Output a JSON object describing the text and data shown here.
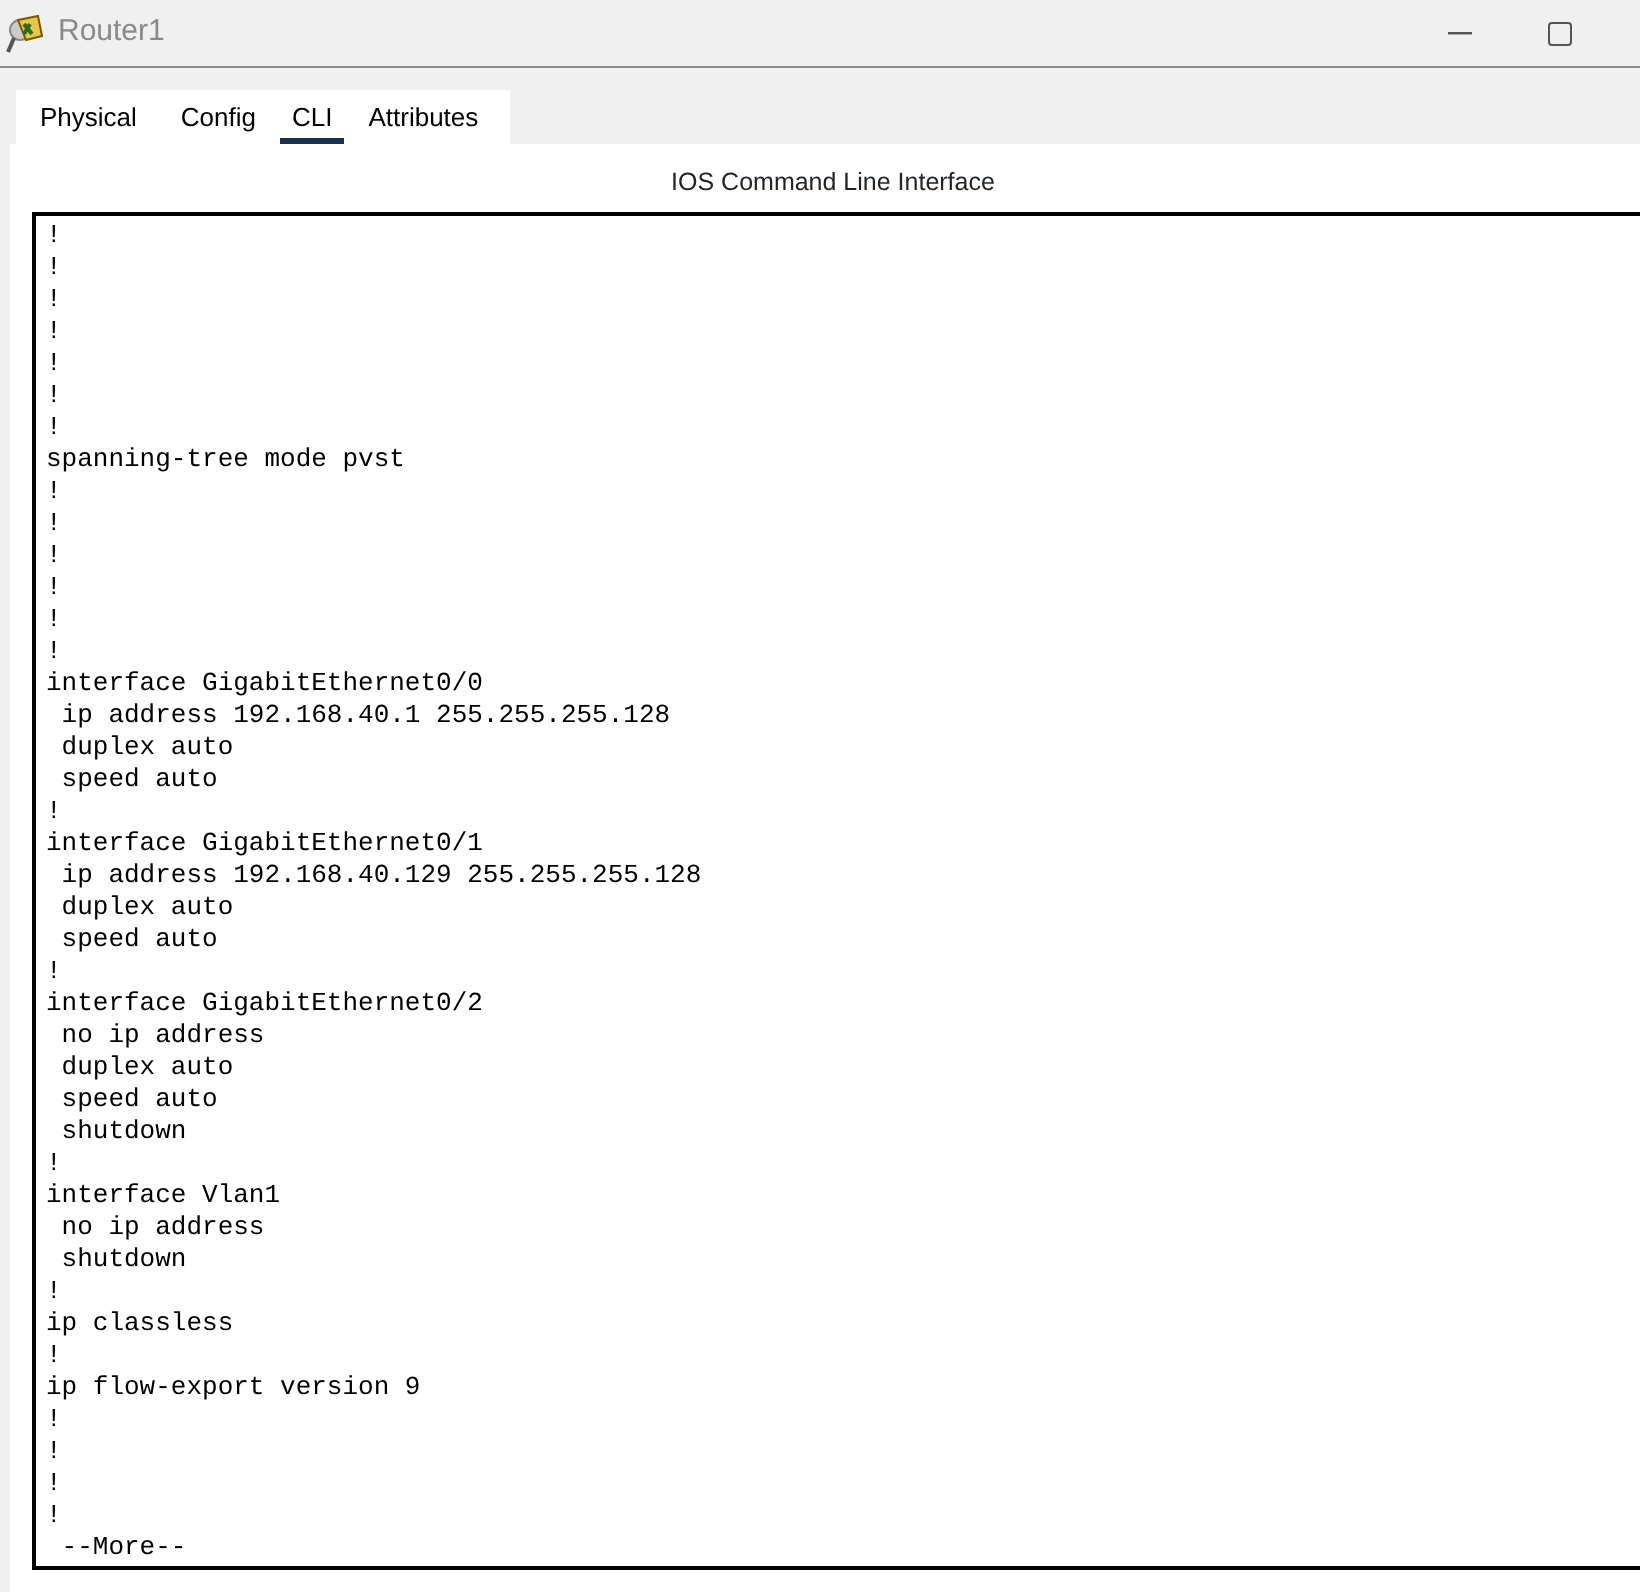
{
  "window": {
    "title": "Router1"
  },
  "tabs": [
    {
      "label": "Physical",
      "selected": false
    },
    {
      "label": "Config",
      "selected": false
    },
    {
      "label": "CLI",
      "selected": true
    },
    {
      "label": "Attributes",
      "selected": false
    }
  ],
  "heading": "IOS Command Line Interface",
  "terminal": {
    "lines": [
      "!",
      "!",
      "!",
      "!",
      "!",
      "!",
      "!",
      "spanning-tree mode pvst",
      "!",
      "!",
      "!",
      "!",
      "!",
      "!",
      "interface GigabitEthernet0/0",
      " ip address 192.168.40.1 255.255.255.128",
      " duplex auto",
      " speed auto",
      "!",
      "interface GigabitEthernet0/1",
      " ip address 192.168.40.129 255.255.255.128",
      " duplex auto",
      " speed auto",
      "!",
      "interface GigabitEthernet0/2",
      " no ip address",
      " duplex auto",
      " speed auto",
      " shutdown",
      "!",
      "interface Vlan1",
      " no ip address",
      " shutdown",
      "!",
      "ip classless",
      "!",
      "ip flow-export version 9",
      "!",
      "!",
      "!",
      "!",
      " --More--"
    ]
  }
}
